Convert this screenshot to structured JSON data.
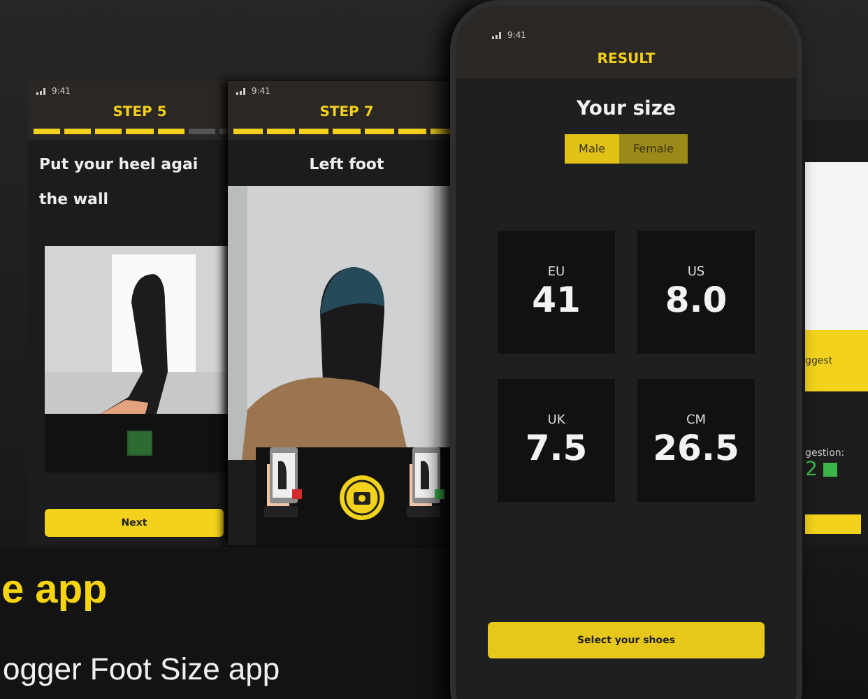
{
  "phones": [
    {
      "kind": "step",
      "status_time": "9:41",
      "step": "STEP 5",
      "progress": [
        {
          "filled": true
        },
        {
          "filled": true
        },
        {
          "filled": true
        },
        {
          "filled": true
        },
        {
          "filled": true
        },
        {
          "filled": false
        },
        {
          "filled": false
        }
      ],
      "title_lines": [
        "Put your heel agai",
        "the wall"
      ],
      "check": {
        "checked": true
      },
      "button": "Next"
    },
    {
      "kind": "camera",
      "status_time": "9:41",
      "step": "STEP 7",
      "progress": [
        {
          "filled": true
        },
        {
          "filled": true
        },
        {
          "filled": true
        },
        {
          "filled": true
        },
        {
          "filled": true
        },
        {
          "filled": true
        },
        {
          "filled": true
        }
      ],
      "title_lines": [
        "Left foot"
      ]
    },
    {
      "kind": "result",
      "status_time": "9:41",
      "header": "RESULT",
      "title": "Your size",
      "genders": [
        {
          "label": "Male",
          "selected": true
        },
        {
          "label": "Female",
          "selected": false
        }
      ],
      "sizes": [
        {
          "unit": "EU",
          "value": "41"
        },
        {
          "unit": "US",
          "value": "8.0"
        },
        {
          "unit": "UK",
          "value": "7.5"
        },
        {
          "unit": "CM",
          "value": "26.5"
        }
      ],
      "button": "Select your shoes"
    },
    {
      "kind": "partial",
      "band": "ggest",
      "label": "gestion:",
      "value": "2"
    }
  ],
  "headline": "e app",
  "subtitle": "ogger Foot Size app"
}
